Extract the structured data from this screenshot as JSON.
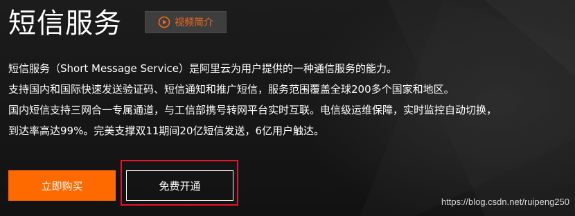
{
  "hero": {
    "title": "短信服务",
    "video_button_label": "视频简介",
    "description_lines": [
      "短信服务（Short Message Service）是阿里云为用户提供的一种通信服务的能力。",
      "支持国内和国际快速发送验证码、短信通知和推广短信，服务范围覆盖全球200多个国家和地区。",
      "国内短信支持三网合一专属通道，与工信部携号转网平台实时互联。电信级运维保障，实时监控自动切换，",
      "到达率高达99%。完美支撑双11期间20亿短信发送，6亿用户触达。"
    ],
    "buy_button_label": "立即购买",
    "free_button_label": "免费开通"
  },
  "watermark": "https://blog.csdn.net/ruipeng250",
  "icons": {
    "video_play": "play-circle-icon"
  },
  "colors": {
    "accent": "#ff6a00",
    "highlight_box": "#e8132c",
    "background": "#141414"
  }
}
